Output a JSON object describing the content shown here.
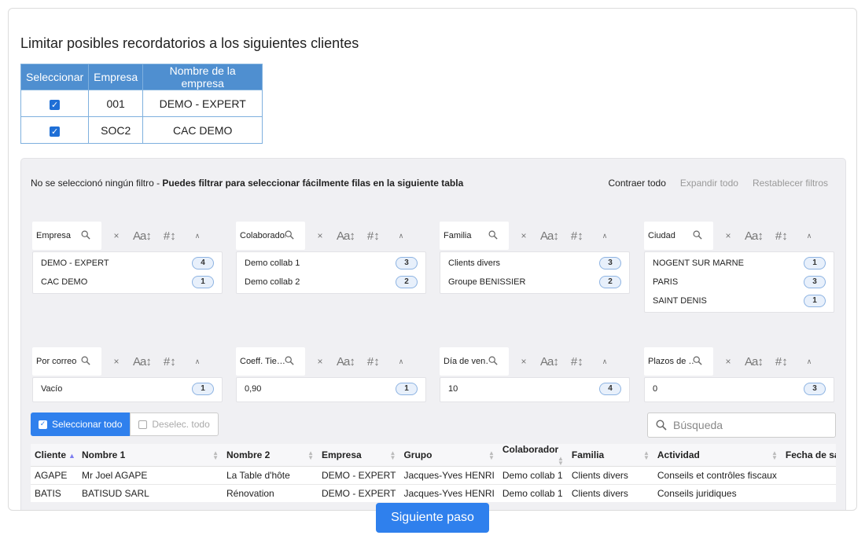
{
  "heading": "Limitar posibles recordatorios a los siguientes clientes",
  "company_table": {
    "headers": [
      "Seleccionar",
      "Empresa",
      "Nombre de la empresa"
    ],
    "rows": [
      {
        "code": "001",
        "name": "DEMO - EXPERT",
        "checked": true
      },
      {
        "code": "SOC2",
        "name": "CAC DEMO",
        "checked": true
      }
    ]
  },
  "filter_panel": {
    "hint_prefix": "No se seleccionó ningún filtro - ",
    "hint_bold": "Puedes filtrar para seleccionar fácilmente filas en la siguiente tabla",
    "collapse_all": "Contraer todo",
    "expand_all": "Expandir todo",
    "reset_filters": "Restablecer filtros"
  },
  "facets": [
    {
      "title": "Empresa",
      "items": [
        {
          "label": "DEMO - EXPERT",
          "count": "4"
        },
        {
          "label": "CAC DEMO",
          "count": "1"
        }
      ]
    },
    {
      "title": "Colaborador",
      "items": [
        {
          "label": "Demo collab 1",
          "count": "3"
        },
        {
          "label": "Demo collab 2",
          "count": "2"
        }
      ]
    },
    {
      "title": "Familia",
      "items": [
        {
          "label": "Clients divers",
          "count": "3"
        },
        {
          "label": "Groupe BENISSIER",
          "count": "2"
        }
      ]
    },
    {
      "title": "Ciudad",
      "items": [
        {
          "label": "NOGENT SUR MARNE",
          "count": "1"
        },
        {
          "label": "PARIS",
          "count": "3"
        },
        {
          "label": "SAINT DENIS",
          "count": "1"
        }
      ]
    },
    {
      "title": "Por correo",
      "items": [
        {
          "label": "Vacío",
          "count": "1"
        }
      ]
    },
    {
      "title": "Coeff. Tie…",
      "items": [
        {
          "label": "0,90",
          "count": "1"
        }
      ]
    },
    {
      "title": "Día de ven…",
      "items": [
        {
          "label": "10",
          "count": "4"
        }
      ]
    },
    {
      "title": "Plazos de …",
      "items": [
        {
          "label": "0",
          "count": "3"
        }
      ]
    }
  ],
  "toolbar": {
    "select_all": "Seleccionar todo",
    "deselect_all": "Deselec. todo",
    "search_placeholder": "Búsqueda"
  },
  "grid": {
    "columns": [
      "Cliente",
      "Nombre 1",
      "Nombre 2",
      "Empresa",
      "Grupo",
      "Colaborador",
      "Familia",
      "Actividad",
      "Fecha de salida"
    ],
    "rows": [
      [
        "AGAPE",
        "Mr Joel AGAPE",
        "La Table d'hôte",
        "DEMO - EXPERT",
        "Jacques-Yves HENRI",
        "Demo collab 1",
        "Clients divers",
        "Conseils et contrôles fiscaux",
        ""
      ],
      [
        "BATIS",
        "BATISUD SARL",
        "Rénovation",
        "DEMO - EXPERT",
        "Jacques-Yves HENRI",
        "Demo collab 1",
        "Clients divers",
        "Conseils juridiques",
        ""
      ]
    ]
  },
  "next_button": "Siguiente paso",
  "colors": {
    "accent": "#2f80ed",
    "table_header": "#4f8fd0"
  }
}
